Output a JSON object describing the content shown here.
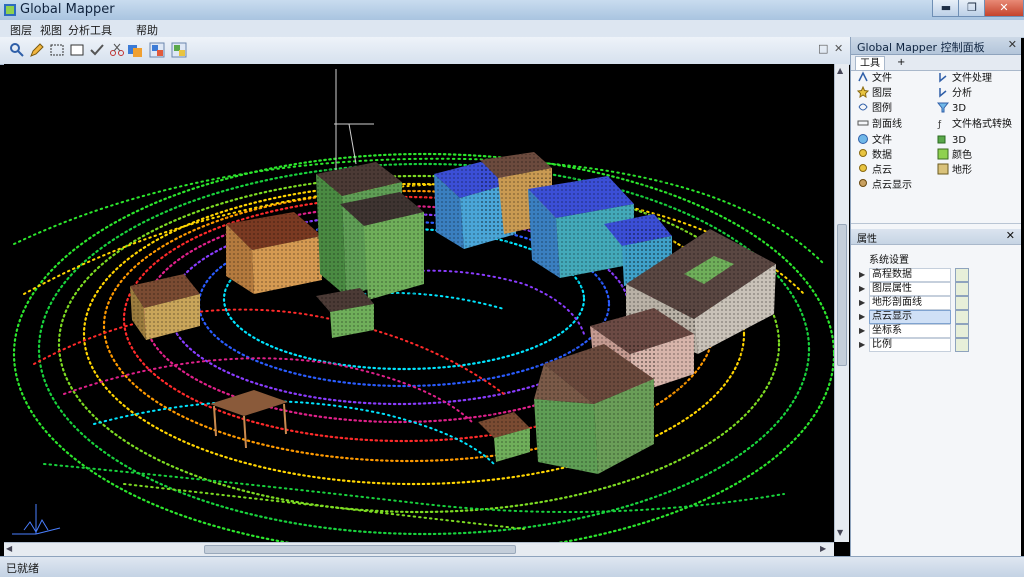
{
  "window": {
    "title": "Global Mapper",
    "controls": [
      "▬",
      "❐",
      "✕"
    ]
  },
  "menu": {
    "items": [
      "图层",
      "视图",
      "分析工具",
      "帮助"
    ]
  },
  "toolbar": {
    "buttons": [
      "zoom-icon",
      "pencil-icon",
      "select-rect-icon",
      "rectangle-icon",
      "check-icon",
      "scissors-icon",
      "layers-icon",
      "layers-icon",
      "layers-icon"
    ],
    "right_controls": [
      "□",
      "✕"
    ]
  },
  "panel": {
    "title": "Global Mapper 控制面板",
    "close": "✕",
    "tabs": [
      "工具",
      "+"
    ],
    "tools_left": [
      {
        "label": "文件",
        "icon": "arrow-icon"
      },
      {
        "label": "图层",
        "icon": "star-icon"
      },
      {
        "label": "图例",
        "icon": "shape-icon"
      },
      {
        "label": "剖面线",
        "icon": "ruler-icon"
      },
      {
        "label": "文件",
        "icon": "globe-icon"
      },
      {
        "label": "数据",
        "icon": "pin-icon"
      },
      {
        "label": "点云",
        "icon": "pin-icon"
      },
      {
        "label": "点云显示",
        "icon": "pin-icon"
      }
    ],
    "tools_right": [
      {
        "label": "文件处理",
        "icon": "cursor-icon"
      },
      {
        "label": "分析",
        "icon": "cursor-icon"
      },
      {
        "label": "3D",
        "icon": "funnel-icon"
      },
      {
        "label": "文件格式转换",
        "icon": "fx-icon"
      },
      {
        "label": "3D",
        "icon": "3d-icon"
      },
      {
        "label": "颜色",
        "icon": "layer-icon"
      },
      {
        "label": "地形",
        "icon": "layer-icon"
      }
    ],
    "section": {
      "title": "属性",
      "close": "✕",
      "subtitle": "系统设置",
      "rows": [
        {
          "label": "高程数据"
        },
        {
          "label": "图层属性"
        },
        {
          "label": "地形剖面线"
        },
        {
          "label": "点云显示"
        },
        {
          "label": "坐标系"
        },
        {
          "label": "比例"
        }
      ]
    }
  },
  "status": {
    "text": "已就绪"
  },
  "colors": {
    "titlebar": "#b5cce6",
    "panel_bg": "#f4f6f9",
    "viewport_bg": "#000000",
    "building_green": "#5f9e55",
    "building_blue": "#4a7fc0",
    "building_roof": "#6b4a3d",
    "point_cyan": "#00e5ff",
    "point_red": "#ff2a2a",
    "point_yellow": "#ffd500",
    "point_green": "#2ce62c"
  }
}
